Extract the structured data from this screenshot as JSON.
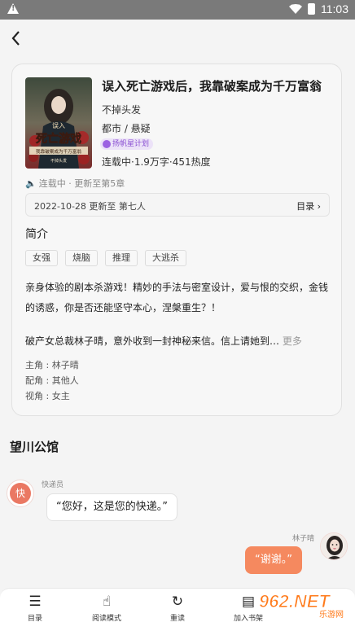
{
  "status_bar": {
    "time": "11:03"
  },
  "book": {
    "title": "误入死亡游戏后，我靠破案成为千万富翁",
    "author": "不掉头发",
    "genre": "都市 / 悬疑",
    "badge": "扬帆星计划",
    "stats": "连载中·1.9万字·451热度",
    "serial_status": "连载中 · 更新至第5章",
    "update_text": "2022-10-28  更新至 第七人",
    "toc_label": "目录 ›",
    "cover_texts": {
      "small": "误入",
      "big": "死亡游戏",
      "sub": "我靠破案成为千万富翁",
      "author": "不掉头发"
    }
  },
  "intro": {
    "title": "简介",
    "tags": [
      "女强",
      "烧脑",
      "推理",
      "大逃杀"
    ],
    "para1": "亲身体验的剧本杀游戏！精妙的手法与密室设计，爱与恨的交织，金钱的诱惑，你是否还能坚守本心，涅槃重生？！",
    "para2": "破产女总裁林子晴，意外收到一封神秘来信。信上请她到…",
    "more": "更多",
    "roles": [
      "主角 : 林子晴",
      "配角 : 其他人",
      "视角 : 女主"
    ]
  },
  "chapter": {
    "title": "望川公馆"
  },
  "messages": [
    {
      "sender": "快递员",
      "avatar_text": "快",
      "text": "“您好，这是您的快递。”"
    },
    {
      "sender": "林子晴",
      "text": "“谢谢。”"
    }
  ],
  "bottom_bar": {
    "items": [
      {
        "label": "目录",
        "icon": "list-icon"
      },
      {
        "label": "阅读模式",
        "icon": "pointer-hand-icon"
      },
      {
        "label": "重读",
        "icon": "restart-icon"
      },
      {
        "label": "加入书架",
        "icon": "bookshelf-icon"
      }
    ]
  },
  "watermark": "962.NET",
  "watermark_sub": "乐游网",
  "colors": {
    "accent": "#f5895f",
    "avatar": "#ea7863",
    "badge": "#9c62e2"
  }
}
